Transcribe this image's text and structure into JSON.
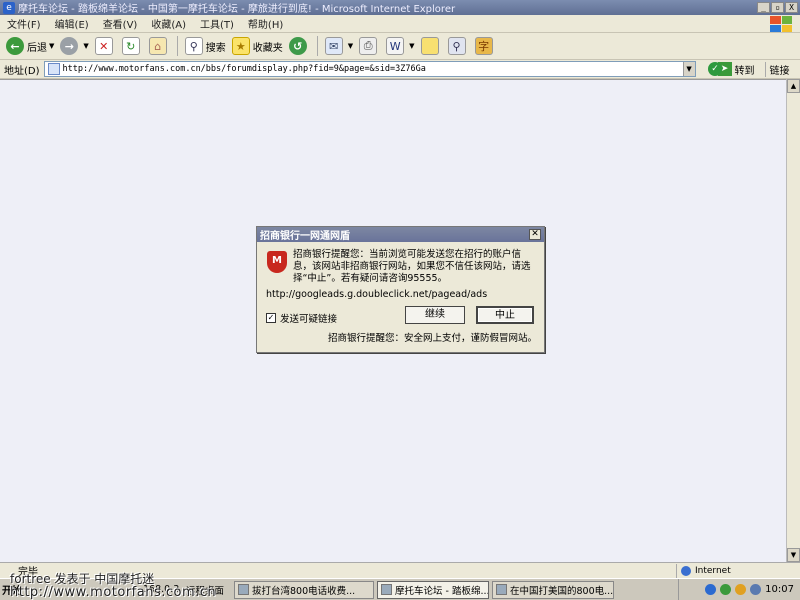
{
  "window": {
    "title": "摩托车论坛 - 踏板绵羊论坛 - 中国第一摩托车论坛 - 摩旅进行到底! - Microsoft Internet Explorer",
    "controls": [
      "_",
      "▫",
      "X"
    ]
  },
  "menu": [
    "文件(F)",
    "编辑(E)",
    "查看(V)",
    "收藏(A)",
    "工具(T)",
    "帮助(H)"
  ],
  "toolbar": {
    "back": "后退",
    "search": "搜索",
    "favorites": "收藏夹"
  },
  "address": {
    "label": "地址(D)",
    "url": "http://www.motorfans.com.cn/bbs/forumdisplay.php?fid=9&page=&sid=3Z76Ga",
    "go": "转到",
    "links": "链接"
  },
  "dialog": {
    "title": "招商银行一网通网盾",
    "message": "招商银行提醒您：当前浏览可能发送您在招行的账户信息，该网站非招商银行网站，如果您不信任该网站，请选择“中止”。若有疑问请咨询95555。",
    "url": "http://googleads.g.doubleclick.net/pagead/ads",
    "checkbox_label": "发送可疑链接",
    "checkbox_checked": true,
    "continue_label": "继续",
    "stop_label": "中止",
    "footer": "招商银行提醒您：安全网上支付，谨防假冒网站。"
  },
  "status": {
    "text": "完毕",
    "zone": "Internet"
  },
  "taskbar": {
    "start": "开始",
    "tasks": [
      "远程桌面",
      "拔打台湾800电话收费...",
      "摩托车论坛 - 踏板绵...",
      "在中国打美国的800电..."
    ],
    "clock": "10:07",
    "partial_ip": "168.0.3.7"
  },
  "watermark": {
    "line1": "fortree 发表于 中国摩托迷",
    "line2": "http://www.motorfans.com.cn"
  }
}
